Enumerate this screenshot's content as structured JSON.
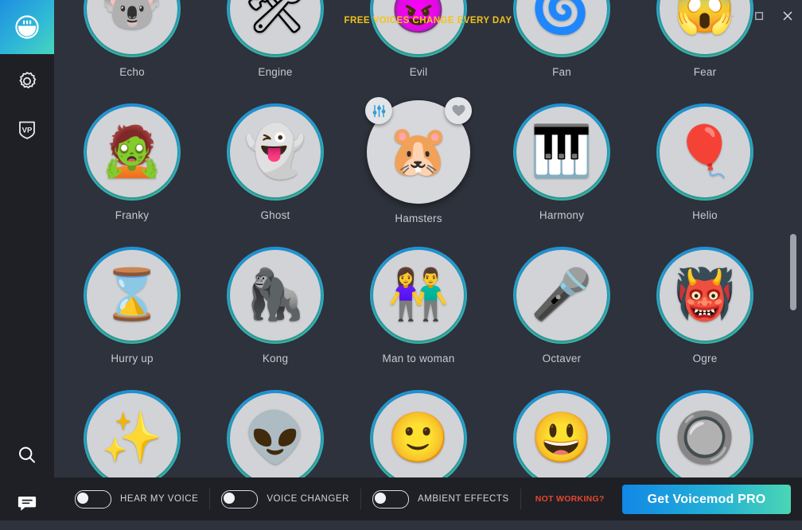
{
  "titlebar": {
    "promo_text": "FREE VOICES CHANGE EVERY DAY",
    "minimize_label": "Minimize",
    "maximize_label": "Maximize",
    "close_label": "Close"
  },
  "sidebar": {
    "items": [
      {
        "icon": "voicebox-icon",
        "label": "Voicebox",
        "active": true
      },
      {
        "icon": "gear-icon",
        "label": "Settings",
        "active": false
      },
      {
        "icon": "vp-shield-icon",
        "label": "Voicelab VP",
        "active": false
      }
    ],
    "bottom_items": [
      {
        "icon": "search-icon",
        "label": "Search"
      },
      {
        "icon": "chat-bubble-icon",
        "label": "Support chat"
      }
    ]
  },
  "voices": [
    {
      "name": "Echo",
      "emoji": "🐨",
      "hovered": false,
      "partial": "top"
    },
    {
      "name": "Engine",
      "emoji": "🛠",
      "hovered": false,
      "partial": "top"
    },
    {
      "name": "Evil",
      "emoji": "😈",
      "hovered": false,
      "partial": "top"
    },
    {
      "name": "Fan",
      "emoji": "🌀",
      "hovered": false,
      "partial": "top"
    },
    {
      "name": "Fear",
      "emoji": "😱",
      "hovered": false,
      "partial": "top"
    },
    {
      "name": "Franky",
      "emoji": "🧟",
      "hovered": false,
      "partial": "none"
    },
    {
      "name": "Ghost",
      "emoji": "👻",
      "hovered": false,
      "partial": "none"
    },
    {
      "name": "Hamsters",
      "emoji": "🐹",
      "hovered": true,
      "partial": "none"
    },
    {
      "name": "Harmony",
      "emoji": "🎹",
      "hovered": false,
      "partial": "none"
    },
    {
      "name": "Helio",
      "emoji": "🎈",
      "hovered": false,
      "partial": "none"
    },
    {
      "name": "Hurry up",
      "emoji": "⌛",
      "hovered": false,
      "partial": "none"
    },
    {
      "name": "Kong",
      "emoji": "🦍",
      "hovered": false,
      "partial": "none"
    },
    {
      "name": "Man to woman",
      "emoji": "👫",
      "hovered": false,
      "partial": "none"
    },
    {
      "name": "Octaver",
      "emoji": "🎤",
      "hovered": false,
      "partial": "none"
    },
    {
      "name": "Ogre",
      "emoji": "👹",
      "hovered": false,
      "partial": "none"
    },
    {
      "name": "",
      "emoji": "✨",
      "hovered": false,
      "partial": "bottom"
    },
    {
      "name": "",
      "emoji": "👽",
      "hovered": false,
      "partial": "bottom"
    },
    {
      "name": "",
      "emoji": "🙂",
      "hovered": false,
      "partial": "bottom"
    },
    {
      "name": "",
      "emoji": "😃",
      "hovered": false,
      "partial": "bottom"
    },
    {
      "name": "",
      "emoji": "🔘",
      "hovered": false,
      "partial": "bottom"
    }
  ],
  "hover_badges": {
    "settings_icon": "sliders-icon",
    "favorite_icon": "heart-icon"
  },
  "bottombar": {
    "toggles": [
      {
        "label": "HEAR MY VOICE",
        "on": false
      },
      {
        "label": "VOICE CHANGER",
        "on": false
      },
      {
        "label": "AMBIENT EFFECTS",
        "on": false
      }
    ],
    "not_working_label": "NOT WORKING?",
    "pro_button_label": "Get Voicemod PRO"
  },
  "colors": {
    "app_bg": "#2e323c",
    "sidebar_bg": "#1e2026",
    "promo_yellow": "#f2c21a",
    "accent_blue": "#1f8fd6",
    "accent_teal": "#3fc9b4",
    "alert_red": "#e8452b",
    "disc_gray": "#d2d3d6"
  },
  "scrollbar": {
    "thumb_top_pct": 45,
    "thumb_height_pct": 18
  }
}
